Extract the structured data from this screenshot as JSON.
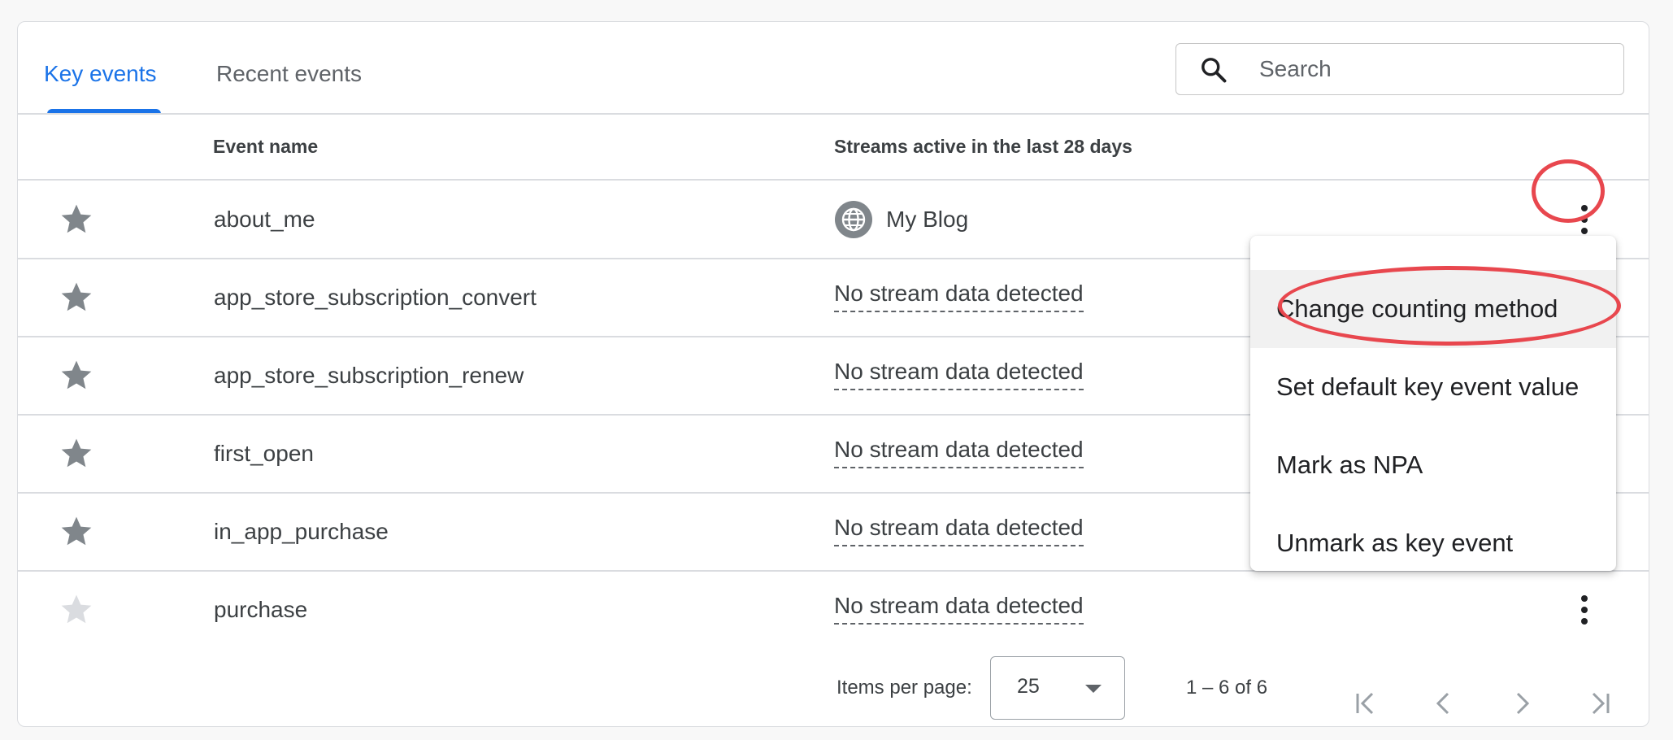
{
  "tabs": [
    {
      "label": "Key events",
      "active": true
    },
    {
      "label": "Recent events",
      "active": false
    }
  ],
  "search": {
    "placeholder": "Search",
    "value": "",
    "icon": "search-icon"
  },
  "table": {
    "columns": [
      "Event name",
      "Streams active in the last 28 days"
    ],
    "rows": [
      {
        "name": "about_me",
        "starred": true,
        "stream": "My Blog",
        "stream_icon": "globe-icon"
      },
      {
        "name": "app_store_subscription_convert",
        "starred": true,
        "stream": "No stream data detected"
      },
      {
        "name": "app_store_subscription_renew",
        "starred": true,
        "stream": "No stream data detected"
      },
      {
        "name": "first_open",
        "starred": true,
        "stream": "No stream data detected"
      },
      {
        "name": "in_app_purchase",
        "starred": true,
        "stream": "No stream data detected"
      },
      {
        "name": "purchase",
        "starred": false,
        "stream": "No stream data detected"
      }
    ]
  },
  "menu": {
    "items": [
      "Change counting method",
      "Set default key event value",
      "Mark as NPA",
      "Unmark as key event"
    ]
  },
  "pagination": {
    "items_per_page_label": "Items per page:",
    "page_size": "25",
    "range": "1 – 6 of 6"
  },
  "colors": {
    "accent": "#1a73e8",
    "annotation": "#e8474e",
    "star_on": "#80868b",
    "star_off": "#dadce0"
  }
}
